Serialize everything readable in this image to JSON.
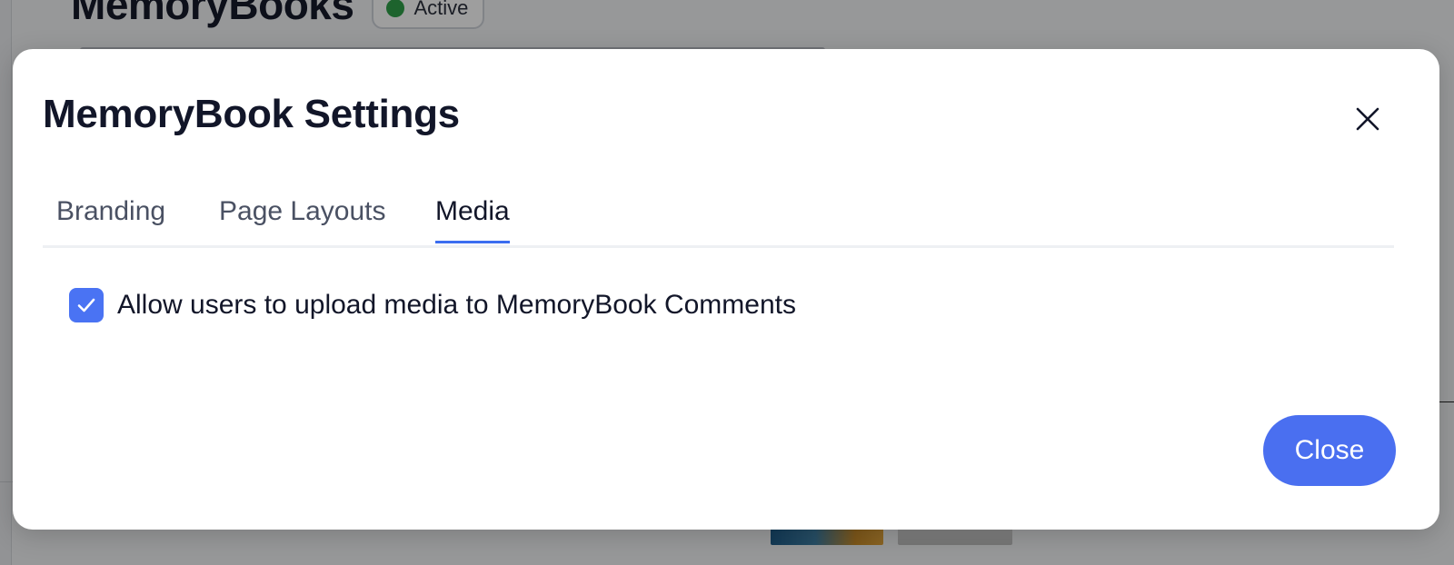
{
  "background": {
    "page_title": "MemoryBooks",
    "status_label": "Active"
  },
  "modal": {
    "title": "MemoryBook Settings",
    "close_icon": "close-icon",
    "tabs": [
      {
        "label": "Branding",
        "active": false
      },
      {
        "label": "Page Layouts",
        "active": false
      },
      {
        "label": "Media",
        "active": true
      }
    ],
    "options": [
      {
        "label": "Allow users to upload media to MemoryBook Comments",
        "checked": true,
        "icon": "check-icon"
      }
    ],
    "close_button_label": "Close"
  },
  "colors": {
    "accent": "#4a6ff0",
    "active_tab_underline": "#3b6df0",
    "status_dot": "#2fa04a",
    "title_text": "#121629"
  }
}
